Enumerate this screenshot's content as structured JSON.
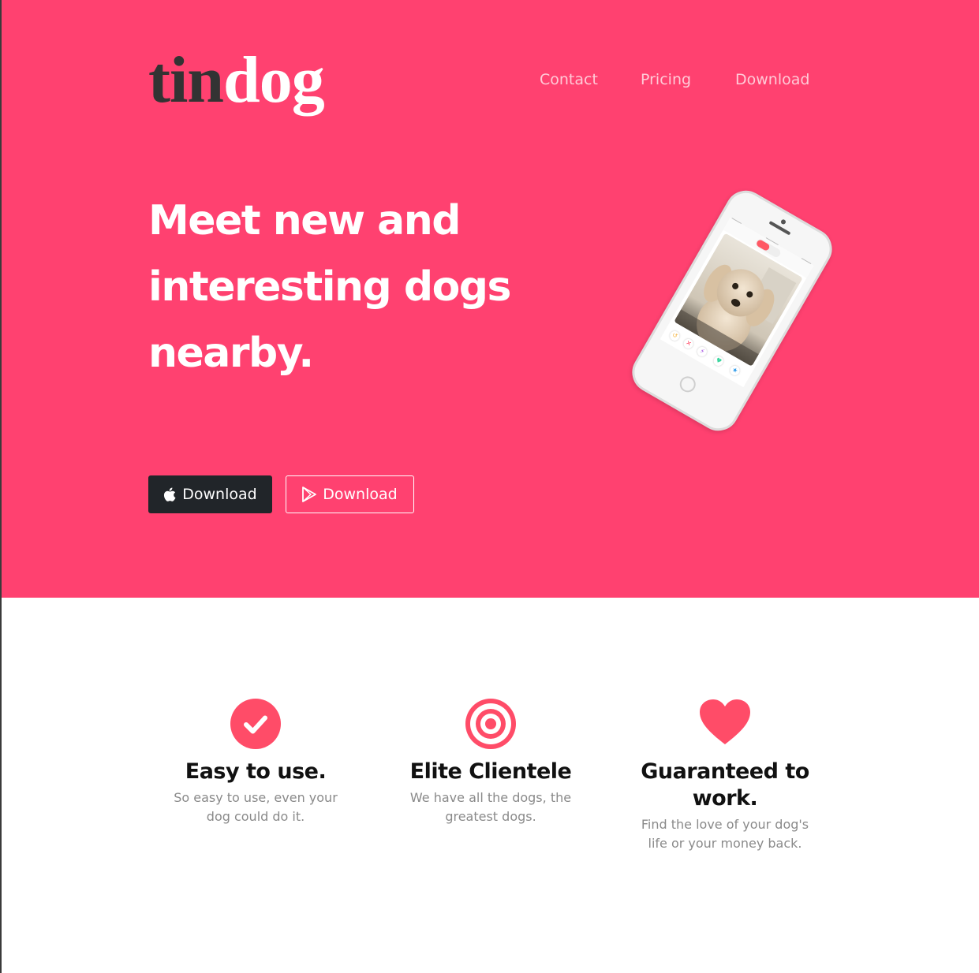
{
  "brand": {
    "part1": "tin",
    "part2": "dog"
  },
  "nav": {
    "items": [
      "Contact",
      "Pricing",
      "Download"
    ]
  },
  "hero": {
    "headline": "Meet new and interesting dogs nearby.",
    "buttons": {
      "apple_label": "Download",
      "apple_icon": "apple-icon",
      "play_label": "Download",
      "play_icon": "play-store-icon"
    },
    "phone_image": "phone-dog-app-image"
  },
  "features": [
    {
      "icon": "check-circle-icon",
      "title": "Easy to use.",
      "text": "So easy to use, even your dog could do it."
    },
    {
      "icon": "bullseye-icon",
      "title": "Elite Clientele",
      "text": "We have all the dogs, the greatest dogs."
    },
    {
      "icon": "heart-icon",
      "title": "Guaranteed to work.",
      "text": "Find the love of your dog's life or your money back."
    }
  ],
  "colors": {
    "hero_bg": "#ff4170",
    "accent": "#ff4c68",
    "dark_button": "#212529",
    "brand_dark": "#333333",
    "muted_text": "#8a8a8a"
  }
}
